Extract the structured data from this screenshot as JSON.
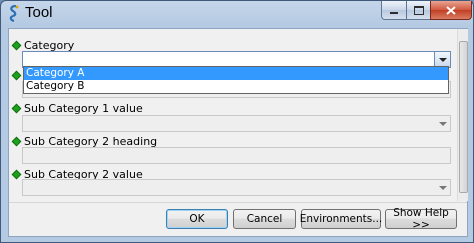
{
  "window": {
    "title": "Tool",
    "controls": {
      "minimize": "minimize",
      "maximize": "maximize",
      "close": "close"
    }
  },
  "parameters": [
    {
      "label": "Category",
      "type": "dropdown",
      "value": "",
      "active": true
    },
    {
      "label": "",
      "type": "dropdown",
      "value": ""
    },
    {
      "label": "Sub Category 1 value",
      "type": "dropdown",
      "value": ""
    },
    {
      "label": "Sub Category 2 heading",
      "type": "text",
      "value": ""
    },
    {
      "label": "Sub Category 2 value",
      "type": "dropdown",
      "value": ""
    }
  ],
  "dropdown": {
    "options": [
      "Category A",
      "Category B"
    ],
    "highlighted": "Category A"
  },
  "buttons": {
    "ok": "OK",
    "cancel": "Cancel",
    "environments": "Environments...",
    "show_help": "Show Help >>"
  },
  "colors": {
    "required_indicator": "#1aa31a",
    "selection": "#3399ff",
    "title_bar": "#b4c9e2",
    "close_button": "#c13f24"
  },
  "icons": {
    "app": "python-script-icon",
    "required": "green-diamond-icon",
    "dropdown": "chevron-down-icon"
  }
}
